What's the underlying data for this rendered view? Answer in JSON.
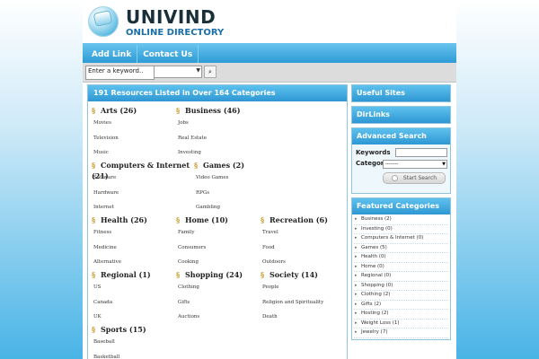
{
  "header": {
    "title": "UNIVIND",
    "subtitle": "ONLINE DIRECTORY",
    "logo_icon": "globe-logo-icon"
  },
  "nav": {
    "items": [
      "Add Link",
      "Contact Us"
    ]
  },
  "search": {
    "keyword_value": "Enter a keyword..",
    "select_value": "",
    "go_icon": "magnifier-icon"
  },
  "main": {
    "heading": "191 Resources Listed in Over 164 Categories",
    "categories": [
      {
        "title": "Arts (26)",
        "subs": [
          "Movies",
          "Television",
          "Music"
        ]
      },
      {
        "title": "Business (46)",
        "subs": [
          "Jobs",
          "Real Estate",
          "Investing"
        ]
      },
      {
        "title": "Computers & Internet (21)",
        "subs": [
          "Software",
          "Hardware",
          "Internet"
        ]
      },
      {
        "title": "Games (2)",
        "subs": [
          "Video Games",
          "RPGs",
          "Gambling"
        ]
      },
      {
        "title": "Health (26)",
        "subs": [
          "Fitness",
          "Medicine",
          "Alternative"
        ]
      },
      {
        "title": "Home (10)",
        "subs": [
          "Family",
          "Consumers",
          "Cooking"
        ]
      },
      {
        "title": "Recreation (6)",
        "subs": [
          "Travel",
          "Food",
          "Outdoors"
        ]
      },
      {
        "title": "Regional (1)",
        "subs": [
          "US",
          "Canada",
          "UK"
        ]
      },
      {
        "title": "Shopping (24)",
        "subs": [
          "Clothing",
          "Gifts",
          "Auctions"
        ]
      },
      {
        "title": "Society (14)",
        "subs": [
          "People",
          "Religion and Spirituality",
          "Death"
        ]
      },
      {
        "title": "Sports (15)",
        "subs": [
          "Baseball",
          "Basketball"
        ]
      }
    ]
  },
  "sidebar": {
    "useful_sites": "Useful Sites",
    "dirlinks": "DirLinks",
    "advanced": {
      "heading": "Advanced Search",
      "keywords_label": "Keywords",
      "category_label": "Category",
      "category_value": "--------",
      "button_label": "Start Search"
    },
    "featured": {
      "heading": "Featured Categories",
      "items": [
        "Business (2)",
        "Investing (0)",
        "Computers & Internet (0)",
        "Games (5)",
        "Health (0)",
        "Home (0)",
        "Regional (0)",
        "Shopping (0)",
        "Clothing (2)",
        "Gifts (2)",
        "Hosting (2)",
        "Weight Loss (1)",
        "Jewelry (7)"
      ]
    }
  },
  "colors": {
    "accent": "#2e97d3",
    "nav_top": "#6ac4ee",
    "link_icon": "#c79a2a"
  }
}
